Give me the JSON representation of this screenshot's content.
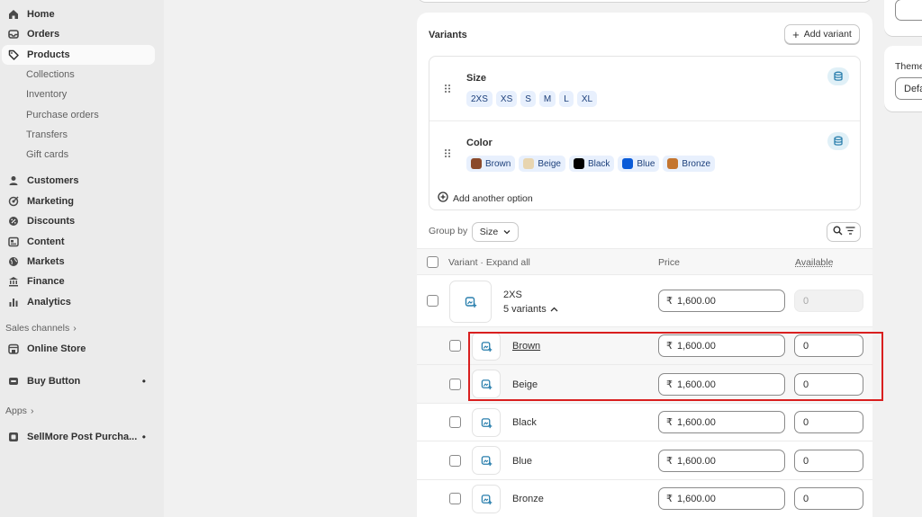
{
  "sidebar": {
    "home": "Home",
    "orders": "Orders",
    "products": "Products",
    "sub_items": [
      "Collections",
      "Inventory",
      "Purchase orders",
      "Transfers",
      "Gift cards"
    ],
    "customers": "Customers",
    "marketing": "Marketing",
    "discounts": "Discounts",
    "content": "Content",
    "markets": "Markets",
    "finance": "Finance",
    "analytics": "Analytics",
    "sales_channels": "Sales channels",
    "online_store": "Online Store",
    "buy_button": "Buy Button",
    "apps": "Apps",
    "sellmore": "SellMore Post Purcha...",
    "dot": "•"
  },
  "variants": {
    "title": "Variants",
    "add_variant": "Add variant",
    "options": [
      {
        "name": "Size",
        "values": [
          "2XS",
          "XS",
          "S",
          "M",
          "L",
          "XL"
        ]
      },
      {
        "name": "Color",
        "values": [
          {
            "label": "Brown",
            "color": "#8b4a2b"
          },
          {
            "label": "Beige",
            "color": "#e8d5b0"
          },
          {
            "label": "Black",
            "color": "#000000"
          },
          {
            "label": "Blue",
            "color": "#0a5bd8"
          },
          {
            "label": "Bronze",
            "color": "#c4752f"
          }
        ]
      }
    ],
    "add_option": "Add another option",
    "group_by_label": "Group by",
    "group_by_value": "Size",
    "table": {
      "col_variant": "Variant · Expand all",
      "col_price": "Price",
      "col_available": "Available"
    },
    "group_row": {
      "name": "2XS",
      "count": "5 variants",
      "price": "1,600.00",
      "available": "0"
    },
    "currency": "₹",
    "rows": [
      {
        "name": "Brown",
        "price": "1,600.00",
        "available": "0"
      },
      {
        "name": "Beige",
        "price": "1,600.00",
        "available": "0"
      },
      {
        "name": "Black",
        "price": "1,600.00",
        "available": "0"
      },
      {
        "name": "Blue",
        "price": "1,600.00",
        "available": "0"
      },
      {
        "name": "Bronze",
        "price": "1,600.00",
        "available": "0"
      }
    ]
  },
  "right": {
    "theme_label": "Theme template",
    "theme_value": "Default product"
  },
  "colors": {
    "highlight": "#d91f1f",
    "chip_bg": "#e8f0fd",
    "icon_blue": "#2a7fad"
  }
}
